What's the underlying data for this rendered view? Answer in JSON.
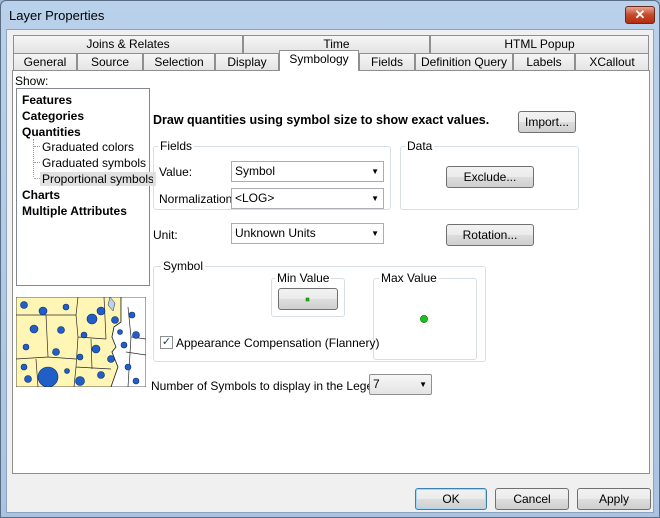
{
  "window": {
    "title": "Layer Properties",
    "close_glyph": "✕"
  },
  "tabs_top": [
    "Joins & Relates",
    "Time",
    "HTML Popup"
  ],
  "tabs_bottom": [
    "General",
    "Source",
    "Selection",
    "Display",
    "Symbology",
    "Fields",
    "Definition Query",
    "Labels",
    "XCallout"
  ],
  "active_tab": "Symbology",
  "show": {
    "label": "Show:",
    "items": [
      {
        "label": "Features",
        "bold": true
      },
      {
        "label": "Categories",
        "bold": true
      },
      {
        "label": "Quantities",
        "bold": true
      },
      {
        "label": "Graduated colors",
        "bold": false
      },
      {
        "label": "Graduated symbols",
        "bold": false
      },
      {
        "label": "Proportional symbols",
        "bold": false,
        "selected": true
      },
      {
        "label": "Charts",
        "bold": true
      },
      {
        "label": "Multiple Attributes",
        "bold": true
      }
    ]
  },
  "heading": "Draw quantities using symbol size to show exact values.",
  "import_label": "Import...",
  "fields": {
    "group_label": "Fields",
    "value_label": "Value:",
    "value": "Symbol",
    "normalization_label": "Normalization:",
    "normalization": "<LOG>"
  },
  "data": {
    "group_label": "Data",
    "exclude_label": "Exclude..."
  },
  "unit": {
    "label": "Unit:",
    "value": "Unknown Units"
  },
  "rotation_label": "Rotation...",
  "symbol": {
    "group_label": "Symbol",
    "min_label": "Min Value",
    "max_label": "Max Value",
    "compensation_label": "Appearance Compensation (Flannery)",
    "compensation_checked": true,
    "check_glyph": "✓"
  },
  "legend": {
    "label": "Number of Symbols to display in the Legend:",
    "value": "7"
  },
  "buttons": {
    "ok": "OK",
    "cancel": "Cancel",
    "apply": "Apply"
  },
  "colors": {
    "preview_land": "#fff6b5",
    "preview_symbol": "#1f5fc7",
    "max_symbol": "#19c219"
  },
  "icons": {
    "dropdown": "dropdown-arrow-icon"
  }
}
